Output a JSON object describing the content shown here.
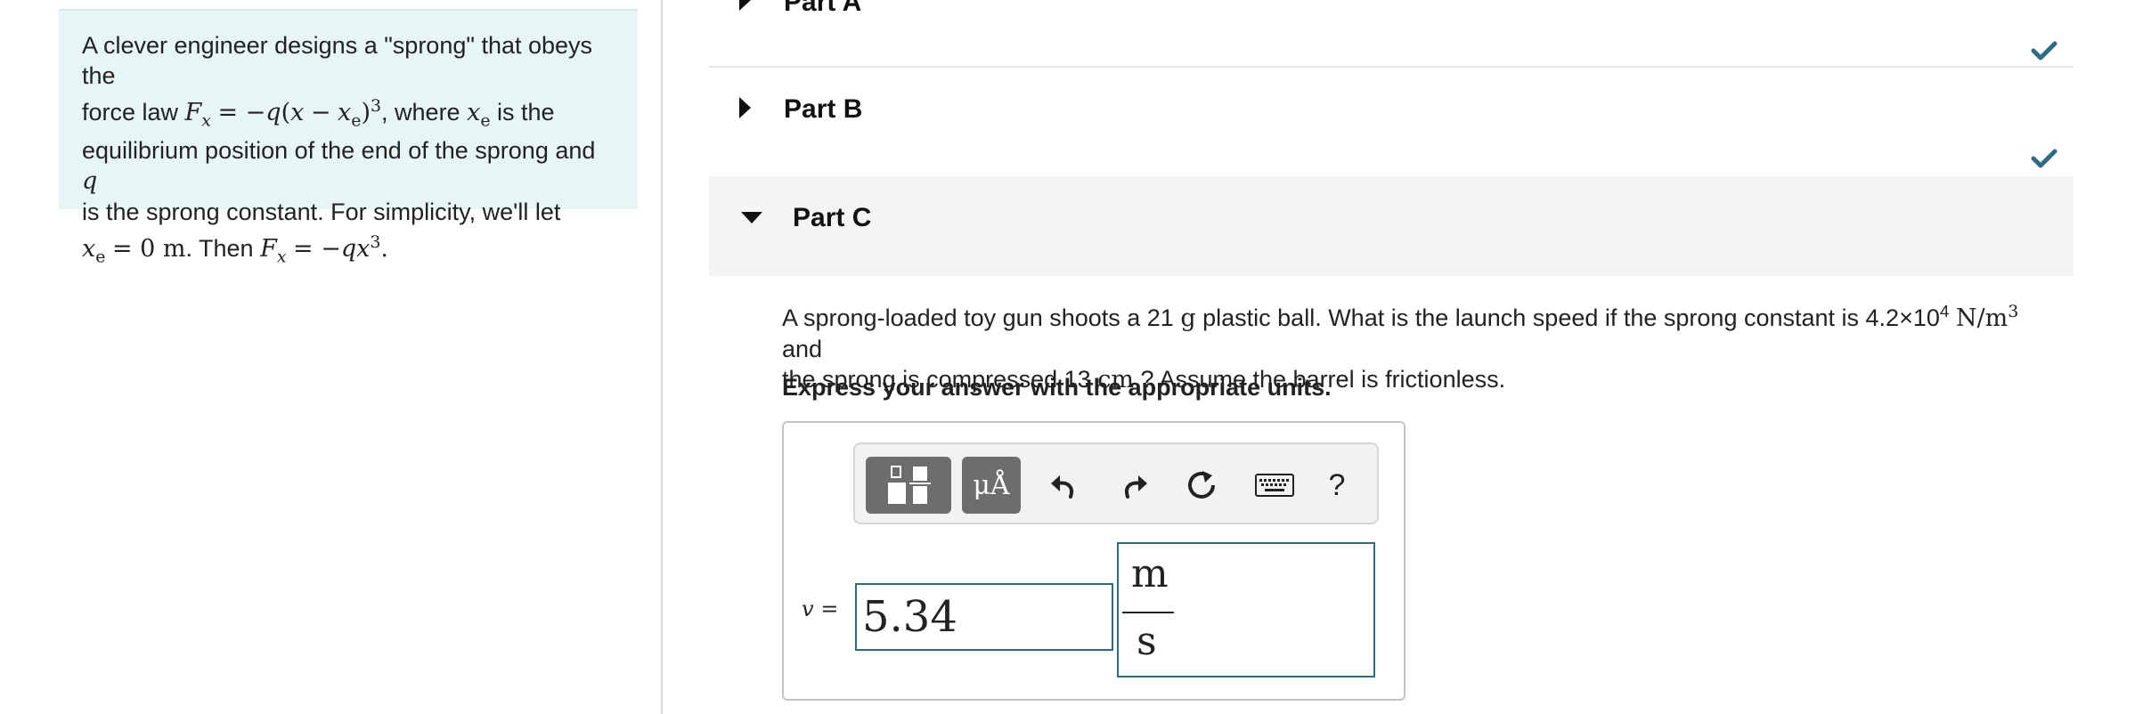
{
  "intro": {
    "l1": "A clever engineer designs a \"sprong\" that obeys the",
    "l2a": "force law ",
    "l2b": ", where ",
    "l2c": " is the",
    "l3": "equilibrium position of the end of the sprong and ",
    "l4": "is the sprong constant. For simplicity, we'll let",
    "l5a": ". Then "
  },
  "parts": {
    "a_label": "Part A",
    "b_label": "Part B",
    "c_label": "Part C"
  },
  "question": {
    "t1": "A sprong-loaded toy gun shoots a 21 ",
    "mass_unit": "g",
    "t2": " plastic ball. What is the launch speed if the sprong constant is 4.2×10",
    "exp": "4",
    "k_unit": "N/m",
    "k_exp": "3",
    "t3": " and",
    "t4": "the sprong is compressed 13 ",
    "len_unit": "cm",
    "t5": " ? Assume the barrel is frictionless."
  },
  "instruction": "Express your answer with the appropriate units.",
  "toolbar": {
    "units_label": "μÅ",
    "help_label": "?"
  },
  "answer": {
    "label": "v =",
    "value": "5.34",
    "unit_numerator": "m",
    "unit_denominator": "s"
  },
  "colors": {
    "intro_bg": "#e8f5f6",
    "check": "#2e6c84",
    "input_border": "#2e6c84"
  }
}
